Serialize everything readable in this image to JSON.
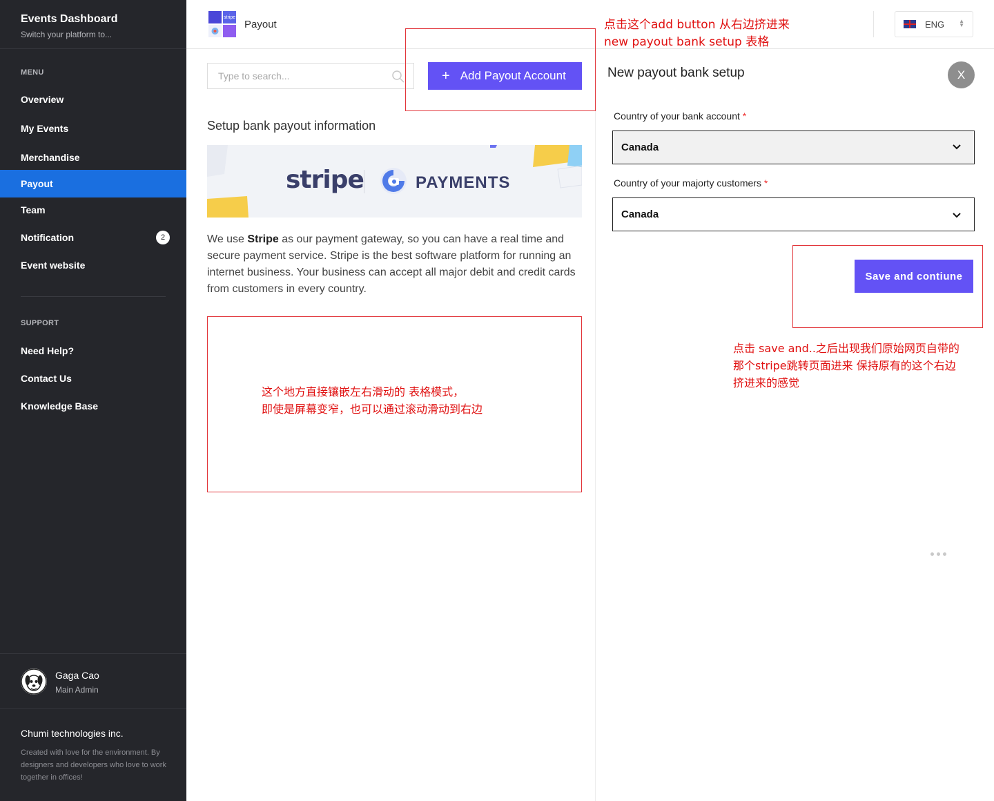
{
  "sidebar": {
    "brand_title": "Events Dashboard",
    "brand_subtitle": "Switch your platform to...",
    "menu_label": "MENU",
    "items": [
      {
        "label": "Overview"
      },
      {
        "label": "My Events"
      },
      {
        "label": "Merchandise"
      },
      {
        "label": "Payout",
        "active": true
      },
      {
        "label": "Team"
      },
      {
        "label": "Notification",
        "badge": "2"
      },
      {
        "label": "Event website"
      }
    ],
    "support_label": "SUPPORT",
    "support_items": [
      {
        "label": "Need Help?"
      },
      {
        "label": "Contact Us"
      },
      {
        "label": "Knowledge Base"
      }
    ],
    "user": {
      "name": "Gaga Cao",
      "role": "Main Admin"
    },
    "company": "Chumi technologies inc.",
    "company_desc": "Created with love for the environment. By designers and developers who love to work together in offices!"
  },
  "header": {
    "title": "Payout",
    "language": "ENG",
    "logo_text": "stripe"
  },
  "main": {
    "search_placeholder": "Type to search...",
    "add_button_label": "Add Payout Account",
    "section_title": "Setup bank payout information",
    "banner": {
      "stripe": "stripe",
      "payments": "PAYMENTS"
    },
    "description_pre": "We use ",
    "description_bold": "Stripe",
    "description_post": " as our payment gateway, so you can have a real time and secure payment service. Stripe is the best software platform for running an internet business. Your business can accept all major debit and credit cards from customers in every country."
  },
  "panel": {
    "title": "New payout bank setup",
    "close_label": "X",
    "field1_label": "Country of your bank account",
    "field1_value": "Canada",
    "field2_label": "Country of your majorty customers",
    "field2_value": "Canada",
    "required_mark": "*",
    "save_label": "Save and contiune"
  },
  "annotations": {
    "top_line1": "点击这个add button 从右边挤进来",
    "top_line2": "new  payout bank setup 表格",
    "middle_line1": "这个地方直接镶嵌左右滑动的 表格模式，",
    "middle_line2": "即使是屏幕变窄，也可以通过滚动滑动到右边",
    "right_line1": "点击 save and..之后出现我们原始网页自带的",
    "right_line2": "那个stripe跳转页面进来 保持原有的这个右边",
    "right_line3": "挤进来的感觉"
  },
  "colors": {
    "sidebar_bg": "#25262b",
    "active_nav": "#1a6fe0",
    "primary_button": "#6352f5",
    "annotation": "#e01010"
  }
}
